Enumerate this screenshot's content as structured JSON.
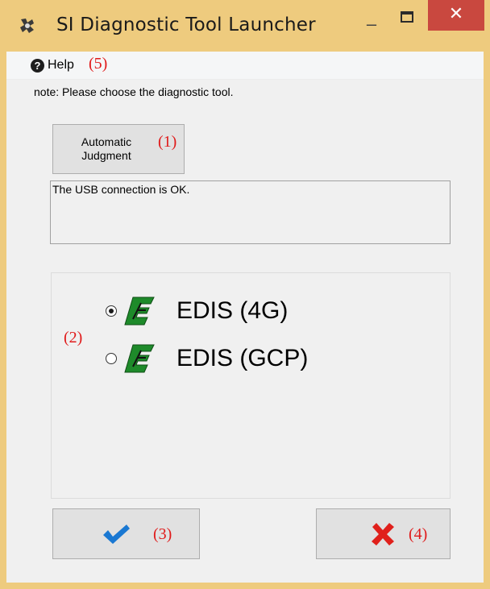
{
  "window": {
    "title": "SI Diagnostic Tool Launcher",
    "minimize_glyph": "–",
    "close_glyph": "✕"
  },
  "menu": {
    "help_label": "Help",
    "help_annotation": "(5)"
  },
  "note": "note: Please choose the diagnostic tool.",
  "auto_judgment": {
    "label_line1": "Automatic",
    "label_line2": "Judgment",
    "annotation": "(1)"
  },
  "status_text": "The USB connection is OK.",
  "tool_group": {
    "annotation": "(2)",
    "options": [
      {
        "label": "EDIS (4G)",
        "selected": true
      },
      {
        "label": "EDIS (GCP)",
        "selected": false
      }
    ]
  },
  "ok_button": {
    "annotation": "(3)",
    "icon": "checkmark-icon"
  },
  "cancel_button": {
    "annotation": "(4)",
    "icon": "red-x-icon"
  },
  "colors": {
    "frame": "#eecb7e",
    "close_button": "#c9483f",
    "annotation": "#e01b1b",
    "edis_green": "#1e8a2a",
    "check_blue": "#1a78d2",
    "cancel_red": "#e0201b"
  }
}
